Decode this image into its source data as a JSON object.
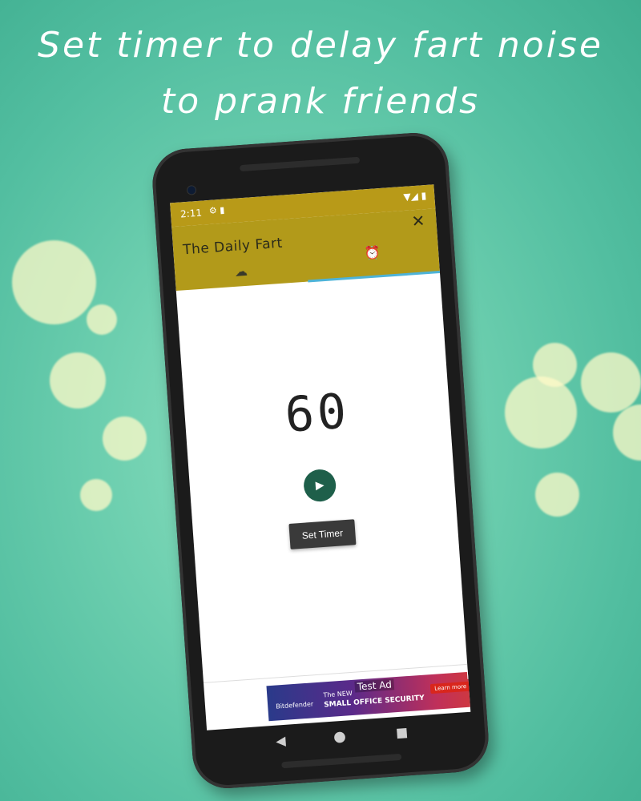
{
  "headline": {
    "line1": "Set timer to delay fart noise",
    "line2": "to prank friends"
  },
  "status_bar": {
    "time": "2:11",
    "left_icons": "⚙ ▮",
    "right_icons": "▼◢ ▮"
  },
  "app_bar": {
    "title": "The Daily Fart",
    "close_icon": "✕"
  },
  "tabs": [
    {
      "icon": "cloud-icon",
      "glyph": "☁",
      "selected": false
    },
    {
      "icon": "alarm-clock-icon",
      "glyph": "⏰",
      "selected": true
    }
  ],
  "timer": {
    "value": "60"
  },
  "controls": {
    "play_glyph": "▶",
    "set_timer_label": "Set Timer"
  },
  "ad": {
    "test_label": "Test Ad",
    "brand": "Bitdefender",
    "line1": "The NEW",
    "line2": "SMALL OFFICE SECURITY",
    "cta": "Learn more",
    "close": "✕"
  },
  "nav": {
    "back": "◀",
    "home": "●",
    "recent": "■"
  },
  "colors": {
    "app_bar": "#b29a1a",
    "play_button": "#1e5f4a",
    "tab_indicator": "#4db3d8"
  }
}
